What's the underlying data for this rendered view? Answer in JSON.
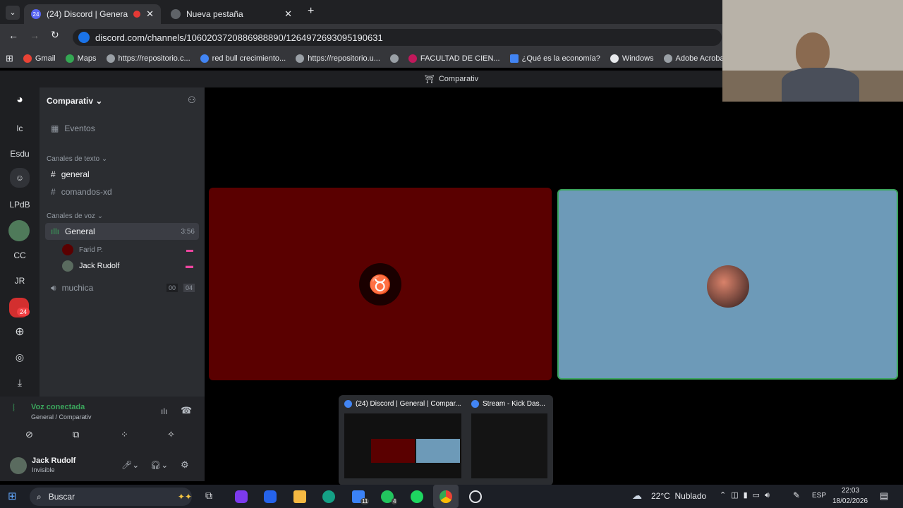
{
  "browser": {
    "tabs": [
      {
        "label": "(24) Discord | General | Com",
        "badge": "24"
      },
      {
        "label": "Nueva pestaña"
      }
    ],
    "url": "discord.com/channels/1060203720886988890/1264972693095190631",
    "bookmarks": [
      "Gmail",
      "Maps",
      "https://repositorio.c...",
      "red bull crecimiento...",
      "https://repositorio.u...",
      "",
      "FACULTAD DE CIEN...",
      "¿Qué es la economía?",
      "Windows",
      "Adobe Acrobat"
    ]
  },
  "window_title": "Comparativ",
  "guilds": [
    "lc",
    "Esdu",
    "LPdB",
    "CC",
    "JR"
  ],
  "guild_badge": "24",
  "server": {
    "name": "Comparativ",
    "events": "Eventos"
  },
  "text_header": "Canales de texto",
  "text_channels": [
    "general",
    "comandos-xd"
  ],
  "voice_header": "Canales de voz",
  "voice_channel": {
    "name": "General",
    "time": "3:56"
  },
  "voice_users": [
    "Farid P.",
    "Jack Rudolf"
  ],
  "voice_channel2": {
    "name": "muchica",
    "count": "00",
    "limit": "04"
  },
  "voice_status": {
    "title": "Voz conectada",
    "sub": "General / Comparativ"
  },
  "user": {
    "name": "Jack Rudolf",
    "status": "Invisible"
  },
  "peek": [
    {
      "title": "(24) Discord | General | Compar..."
    },
    {
      "title": "Stream - Kick Das..."
    }
  ],
  "taskbar": {
    "search": "Buscar",
    "weather": "22°C  Nublado",
    "lang": "ESP",
    "time": "22:03",
    "date": "18/02/2026",
    "mail_badge": "11",
    "wa_badge": "4"
  }
}
